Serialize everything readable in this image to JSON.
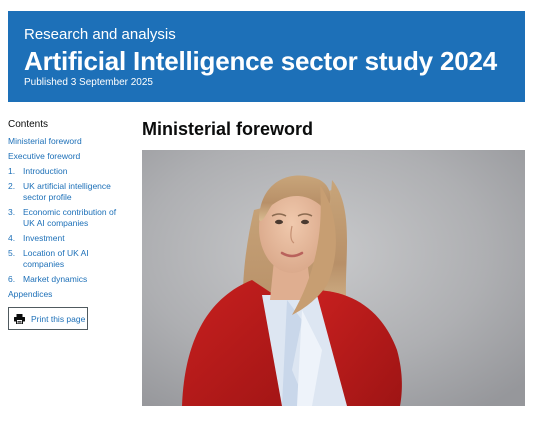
{
  "banner": {
    "kicker": "Research and analysis",
    "title": "Artificial Intelligence sector study 2024",
    "published": "Published 3 September 2025",
    "background_color": "#1d70b8"
  },
  "contents": {
    "title": "Contents",
    "items": [
      {
        "number": "",
        "label": "Ministerial foreword"
      },
      {
        "number": "",
        "label": "Executive foreword"
      },
      {
        "number": "1.",
        "label": "Introduction"
      },
      {
        "number": "2.",
        "label": "UK artificial intelligence sector profile"
      },
      {
        "number": "3.",
        "label": "Economic contribution of UK AI companies"
      },
      {
        "number": "4.",
        "label": "Investment"
      },
      {
        "number": "5.",
        "label": "Location of UK AI companies"
      },
      {
        "number": "6.",
        "label": "Market dynamics"
      },
      {
        "number": "",
        "label": "Appendices"
      }
    ],
    "link_color": "#1d70b8"
  },
  "print": {
    "label": "Print this page",
    "icon": "printer-icon"
  },
  "main": {
    "heading": "Ministerial foreword",
    "image": {
      "description_name": "minister-portrait"
    }
  }
}
